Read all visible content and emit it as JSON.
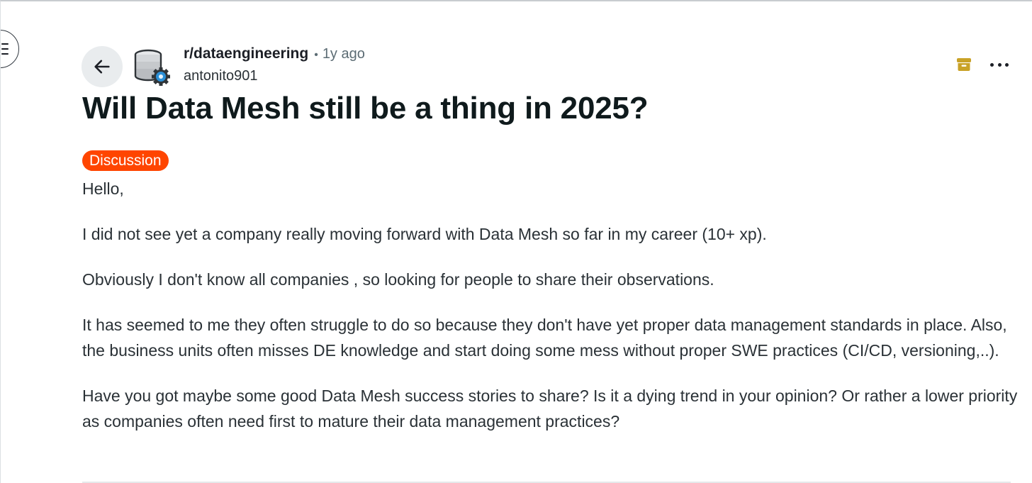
{
  "post": {
    "subreddit": "r/dataengineering",
    "separator": "•",
    "time_ago": "1y ago",
    "author": "antonito901",
    "title": "Will Data Mesh still be a thing in 2025?",
    "flair": "Discussion",
    "body": [
      "Hello,",
      "I did not see yet a company really moving forward with Data Mesh so far in my career (10+ xp).",
      "Obviously I don't know all companies , so looking for people to share their observations.",
      "It has seemed to me they often struggle to do so because they don't have yet proper data management standards in place. Also, the business units often misses DE knowledge and start doing some mess without proper SWE practices (CI/CD, versioning,..).",
      "Have you got maybe some good Data Mesh success stories to share? Is it a dying trend in your opinion? Or rather a lower priority as companies often need first to mature their data management practices?"
    ]
  },
  "icons": {
    "sidebar_toggle": "hamburger-icon",
    "back": "arrow-left-icon",
    "avatar": "database-gear-icon",
    "archive": "archive-icon",
    "more": "more-horizontal-icon"
  },
  "colors": {
    "flair_bg": "#ff4500",
    "archive_icon": "#c9a227",
    "avatar_gear": "#2b8fd6"
  }
}
